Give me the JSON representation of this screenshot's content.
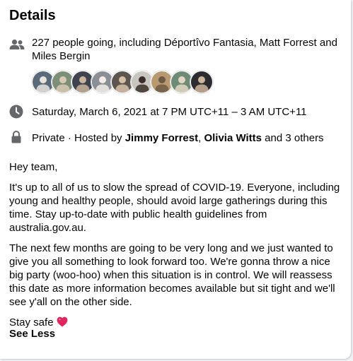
{
  "details": {
    "title": "Details",
    "going": {
      "icon": "people-icon",
      "text": "227 people going, including Déportîvo Fantasia, Matt Forrest and Miles Bergin"
    },
    "attendee_avatars": [
      {
        "name": "attendee-avatar-1",
        "bg": "#5b6a7a",
        "fg": "#e9e3dc"
      },
      {
        "name": "attendee-avatar-2",
        "bg": "#7d8f78",
        "fg": "#d8c9b5"
      },
      {
        "name": "attendee-avatar-3",
        "bg": "#3f4350",
        "fg": "#c9b39b"
      },
      {
        "name": "attendee-avatar-4",
        "bg": "#8a8f96",
        "fg": "#f1ece6"
      },
      {
        "name": "attendee-avatar-5",
        "bg": "#5d5650",
        "fg": "#d7c0a8"
      },
      {
        "name": "attendee-avatar-6",
        "bg": "#c9c6c0",
        "fg": "#3a2f28"
      },
      {
        "name": "attendee-avatar-7",
        "bg": "#b99a70",
        "fg": "#6d5a44"
      },
      {
        "name": "attendee-avatar-8",
        "bg": "#6e8b76",
        "fg": "#e4d6c4"
      },
      {
        "name": "attendee-avatar-9",
        "bg": "#2c2c30",
        "fg": "#cdb59a"
      }
    ],
    "date": {
      "icon": "clock-icon",
      "text": "Saturday, March 6, 2021 at 7 PM UTC+11 – 3 AM UTC+11"
    },
    "privacy": {
      "icon": "lock-icon",
      "prefix": "Private · Hosted by ",
      "host1": "Jimmy Forrest",
      "separator": ", ",
      "host2": "Olivia Witts",
      "suffix": " and 3 others"
    },
    "description": {
      "greeting": "Hey team,",
      "para1": "It's up to all of us to slow the spread of COVID-19. Everyone, including young and healthy people, should avoid large gatherings during this time. Stay up-to-date with public health guidelines from australia.gov.au.",
      "para2": "The next few months are going to be very long and we just wanted to give you all something to look forward too. We're gonna throw a nice big party (woo-hoo) when this situation is in control. We will reassess this date as more information becomes available but sit tight and we'll see y'all on the other side.",
      "signoff": "Stay safe",
      "signoff_icon": "red-heart-icon"
    },
    "see_less_label": "See Less"
  },
  "colors": {
    "text": "#050505",
    "icon": "#65676b",
    "heart": "#e0245e",
    "card": "#ffffff",
    "page": "#f0f2f5"
  }
}
